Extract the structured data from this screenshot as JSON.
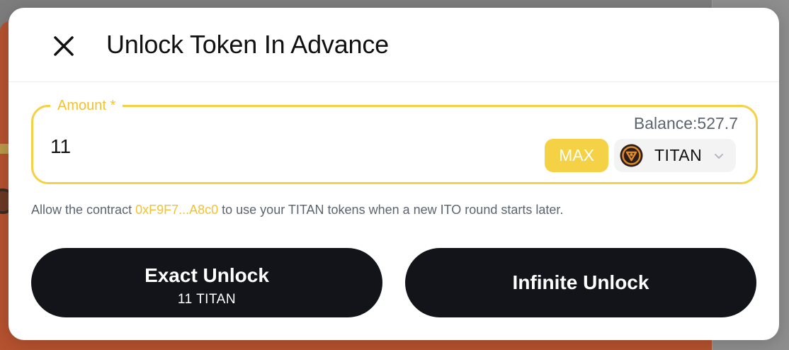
{
  "modal": {
    "title": "Unlock Token In Advance",
    "close_icon": "close-icon"
  },
  "amount_field": {
    "label": "Amount *",
    "value": "11",
    "balance_label": "Balance:527.7",
    "max_label": "MAX",
    "token": {
      "symbol": "TITAN",
      "logo_icon": "titan-token-icon",
      "chevron_icon": "chevron-down-icon"
    }
  },
  "description": {
    "prefix": "Allow the contract ",
    "contract_address": "0xF9F7...A8c0",
    "suffix": " to use your TITAN tokens when a new ITO round starts later."
  },
  "buttons": {
    "exact": {
      "label": "Exact Unlock",
      "sub_label": "11 TITAN"
    },
    "infinite": {
      "label": "Infinite Unlock"
    }
  },
  "colors": {
    "accent": "#F5D145",
    "accent_text": "#F1C232",
    "button_dark": "#12141A",
    "muted_text": "#5C6470"
  }
}
